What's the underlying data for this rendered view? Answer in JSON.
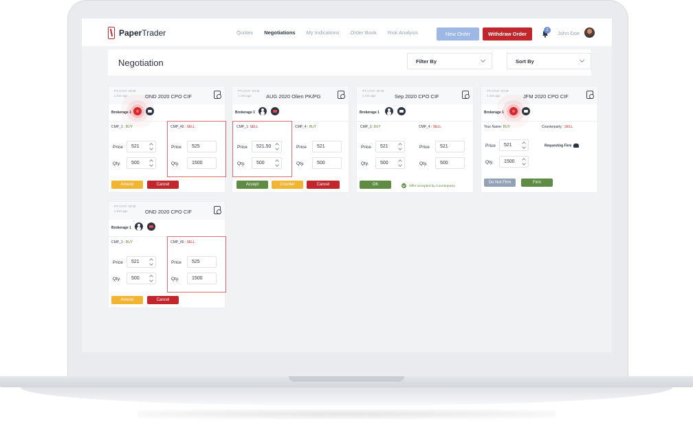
{
  "app": {
    "name_bold": "Paper",
    "name_rest": "Trader"
  },
  "nav": {
    "items": [
      "Quotes",
      "Negotiations",
      "My Indications",
      "Order Book",
      "Risk Analysis"
    ],
    "active": "Negotiations",
    "new_order": "New Order",
    "withdraw_order": "Withdraw Order",
    "notification_count": "2",
    "user": "John Doe"
  },
  "page": {
    "title": "Negotiation",
    "filter_label": "Filter By",
    "sort_label": "Sort By"
  },
  "cards": [
    {
      "ticket": "PT-A7H7- N7J9",
      "time": "1 min ago",
      "product": "OND 2020  CPO CIF",
      "brokerage": "Brokerage 1",
      "left_party": "CMP_1 : ",
      "left_side": "BUY",
      "right_party": "CMP_45 : ",
      "right_side": "SELL",
      "price_label": "Price",
      "qty_label": "Qty.",
      "left_price": "521",
      "left_qty": "500",
      "right_price": "525",
      "right_qty": "1500",
      "btn1": "Amend",
      "btn2": "Cancel"
    },
    {
      "ticket": "PT-A7H7- N7J9",
      "time": "1 min ago",
      "product": "AUG 2020 Olien PK/PG",
      "brokerage": "Brokerage 1",
      "left_party": "CMP_1: ",
      "left_side": "SELL",
      "right_party": "CMP_4 : ",
      "right_side": "BUY",
      "price_label": "Price",
      "qty_label": "Qty.",
      "left_price": "521.50",
      "left_qty": "500",
      "right_price": "521",
      "right_qty": "500",
      "btn1": "Accept",
      "btn2": "Counter",
      "btn3": "Cancel"
    },
    {
      "ticket": "PT-A7H7- N7J9",
      "time": "1 min ago",
      "product": "Sep 2020  CPO CIF",
      "brokerage": "Brokerage 1",
      "left_party": "CMP_1: ",
      "left_side": "BUY",
      "right_party": "CMP_4 : ",
      "right_side": "SELL",
      "price_label": "Price",
      "qty_label": "Qty.",
      "left_price": "521",
      "left_qty": "500",
      "right_price": "521",
      "right_qty": "500",
      "btn1": "OK",
      "accepted_text": "Offer accepted by Counterparty"
    },
    {
      "ticket": "PT-A7H7- N7J9",
      "time": "1 min ago",
      "product": "JFM 2020  CPO CIF",
      "brokerage": "Brokerage 1",
      "left_party": "Your Name: ",
      "left_side": "BUY",
      "right_party": "Counterparty : ",
      "right_side": "SELL",
      "price_label": "Price",
      "qty_label": "Qty.",
      "left_price": "521",
      "left_qty": "1500",
      "requesting_firm": "Requesting Firm",
      "btn1": "Do Not Firm",
      "btn2": "Firm"
    },
    {
      "ticket": "PT-A7H7- N7J9",
      "time": "1 min ago",
      "product": "OND 2020  CPO CIF",
      "brokerage": "Brokerage 1",
      "left_party": "CMP_1 : ",
      "left_side": "BUY",
      "right_party": "CMP_45 : ",
      "right_side": "SELL",
      "price_label": "Price",
      "qty_label": "Qty.",
      "left_price": "521",
      "left_qty": "500",
      "right_price": "525",
      "right_qty": "1500",
      "btn1": "Amend",
      "btn2": "Cancel"
    }
  ],
  "colors": {
    "brand_red": "#c0262c",
    "buy_green": "#5a8a2e",
    "amber": "#f2b433",
    "blue": "#9db8e4"
  }
}
